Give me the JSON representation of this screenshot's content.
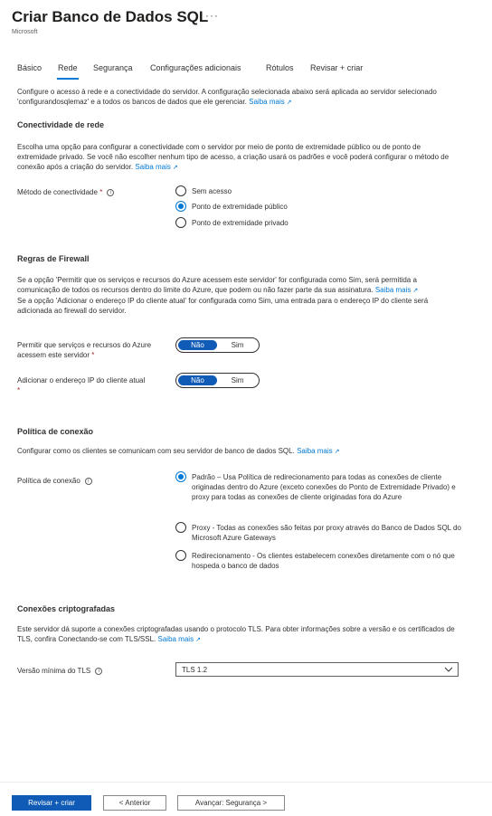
{
  "header": {
    "title": "Criar Banco de Dados SQL",
    "more": "···",
    "publisher": "Microsoft"
  },
  "tabs": [
    "Básico",
    "Rede",
    "Segurança",
    "Configurações adicionais",
    "Rótulos",
    "Revisar + criar"
  ],
  "active_tab": "Rede",
  "intro": {
    "text": "Configure o acesso à rede e a conectividade do servidor. A configuração selecionada abaixo será aplicada ao servidor selecionado 'configurandosqlemaz' e a todos os bancos de dados que ele gerenciar.",
    "link": "Saiba mais"
  },
  "connectivity": {
    "heading": "Conectividade de rede",
    "text": "Escolha uma opção para configurar a conectividade com o servidor por meio de ponto de extremidade público ou de ponto de extremidade privado. Se você não escolher nenhum tipo de acesso, a criação usará os padrões e você poderá configurar o método de conexão após a criação do servidor.",
    "link": "Saiba mais",
    "label": "Método de conectividade",
    "options": [
      "Sem acesso",
      "Ponto de extremidade público",
      "Ponto de extremidade privado"
    ],
    "selected": "Ponto de extremidade público"
  },
  "firewall": {
    "heading": "Regras de Firewall",
    "text1": "Se a opção 'Permitir que os serviços e recursos do Azure acessem este servidor' for configurada como Sim, será permitida a comunicação de todos os recursos dentro do limite do Azure, que podem ou não fazer parte da sua assinatura.",
    "link1a": "Saiba",
    "link1b": "mais",
    "text2": "Se a opção 'Adicionar o endereço IP do cliente atual' for configurada como Sim, uma entrada para o endereço IP do cliente será adicionada ao firewall do servidor.",
    "allow_azure_label_1": "Permitir que serviços e recursos do Azure",
    "allow_azure_label_2": "acessem este servidor",
    "add_ip_label": "Adicionar o endereço IP do cliente atual",
    "toggle_no": "Não",
    "toggle_yes": "Sim",
    "allow_azure_value": "Não",
    "add_ip_value": "Não"
  },
  "policy": {
    "heading": "Política de conexão",
    "text": "Configurar como os clientes se comunicam com seu servidor de banco de dados SQL.",
    "link": "Saiba mais",
    "label": "Política de conexão",
    "options": [
      "Padrão – Usa Política de redirecionamento para todas as conexões de cliente originadas dentro do Azure (exceto conexões do Ponto de Extremidade Privado) e proxy para todas as conexões de cliente originadas fora do Azure",
      "Proxy - Todas as conexões são feitas por proxy através do Banco de Dados SQL do Microsoft Azure Gateways",
      "Redirecionamento - Os clientes estabelecem conexões diretamente com o nó que hospeda o banco de dados"
    ],
    "selected_index": 0
  },
  "tls": {
    "heading": "Conexões criptografadas",
    "text": "Este servidor dá suporte a conexões criptografadas usando o protocolo TLS. Para obter informações sobre a versão e os certificados de TLS, confira Conectando-se com TLS/SSL.",
    "link": "Saiba mais",
    "label": "Versão mínima do TLS",
    "value": "TLS 1.2"
  },
  "footer": {
    "review": "Revisar + criar",
    "previous": "< Anterior",
    "next": "Avançar: Segurança >"
  },
  "colors": {
    "accent": "#0078d4",
    "primary_button": "#0f5bb5",
    "required": "#a4262c"
  },
  "icons": {
    "info": "info-icon",
    "external_link": "external-link-icon",
    "chevron": "chevron-down-icon"
  }
}
